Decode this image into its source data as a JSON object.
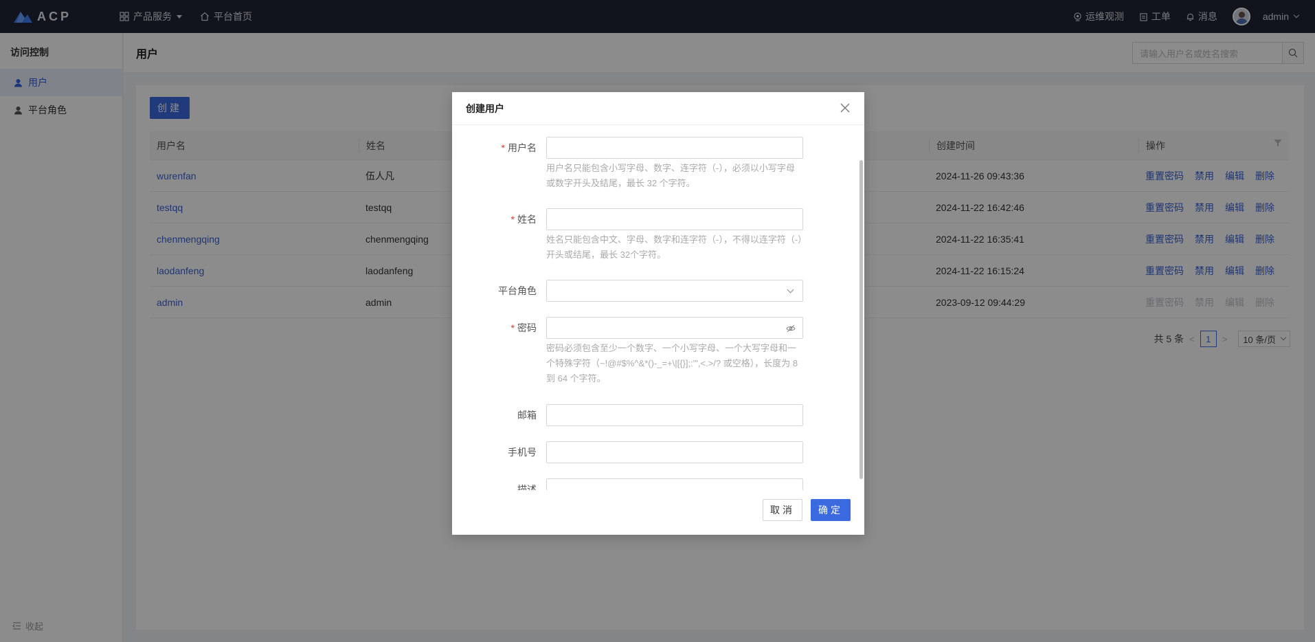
{
  "app": {
    "logo_text": "ACP"
  },
  "topnav": {
    "products": "产品服务",
    "home": "平台首页",
    "ops": "运维观测",
    "tickets": "工单",
    "messages": "消息",
    "user": "admin"
  },
  "sidebar": {
    "title": "访问控制",
    "items": [
      {
        "label": "用户"
      },
      {
        "label": "平台角色"
      }
    ],
    "collapse": "收起"
  },
  "page": {
    "title": "用户",
    "search_placeholder": "请输入用户名或姓名搜索"
  },
  "toolbar": {
    "create": "创建"
  },
  "table": {
    "headers": [
      "用户名",
      "姓名",
      "创建时间",
      "操作"
    ],
    "ops": [
      "重置密码",
      "禁用",
      "编辑",
      "删除"
    ],
    "rows": [
      {
        "username": "wurenfan",
        "name": "伍人凡",
        "created": "2024-11-26 09:43:36"
      },
      {
        "username": "testqq",
        "name": "testqq",
        "created": "2024-11-22 16:42:46"
      },
      {
        "username": "chenmengqing",
        "name": "chenmengqing",
        "created": "2024-11-22 16:35:41"
      },
      {
        "username": "laodanfeng",
        "name": "laodanfeng",
        "created": "2024-11-22 16:15:24"
      },
      {
        "username": "admin",
        "name": "admin",
        "created": "2023-09-12 09:44:29"
      }
    ]
  },
  "pager": {
    "total": "共 5 条",
    "current": "1",
    "size": "10 条/页"
  },
  "modal": {
    "title": "创建用户",
    "fields": {
      "username": {
        "label": "用户名",
        "hint": "用户名只能包含小写字母、数字、连字符（-），必须以小写字母或数字开头及结尾，最长 32 个字符。"
      },
      "name": {
        "label": "姓名",
        "hint": "姓名只能包含中文、字母、数字和连字符（-），不得以连字符（-）开头或结尾，最长 32个字符。"
      },
      "role": {
        "label": "平台角色"
      },
      "password": {
        "label": "密码",
        "hint": "密码必须包含至少一个数字、一个小写字母、一个大写字母和一个特殊字符（~!@#$%^&*()-_=+\\|[{}];:'\",<.>/? 或空格），长度为 8 到 64 个字符。"
      },
      "email": {
        "label": "邮箱"
      },
      "phone": {
        "label": "手机号"
      },
      "description": {
        "label": "描述"
      }
    },
    "cancel": "取消",
    "confirm": "确定"
  },
  "colors": {
    "primary": "#3b6ae0",
    "topbar": "#1f2533",
    "required": "#e53935"
  }
}
